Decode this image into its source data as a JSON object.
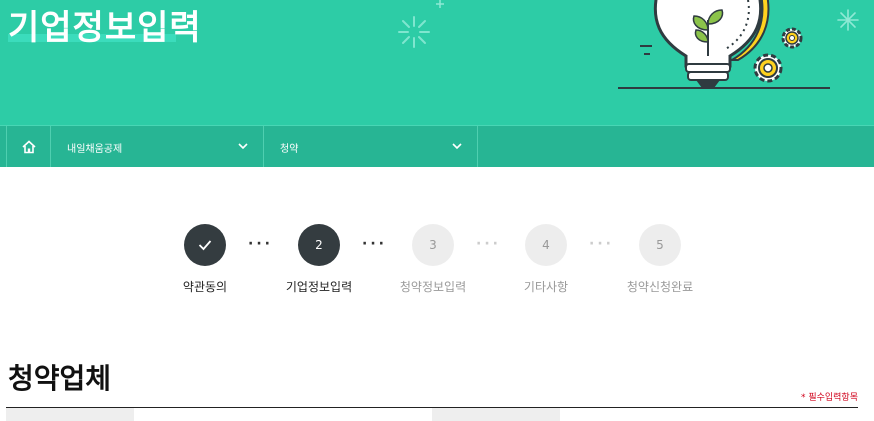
{
  "banner": {
    "title": "기업정보입력"
  },
  "nav": {
    "home_icon": "home-icon",
    "dropdowns": [
      {
        "label": "내일채움공제",
        "icon": "chevron-down-icon"
      },
      {
        "label": "청약",
        "icon": "chevron-down-icon"
      }
    ]
  },
  "steps": [
    {
      "number": "",
      "label": "약관동의",
      "state": "done",
      "icon": "check-icon"
    },
    {
      "number": "2",
      "label": "기업정보입력",
      "state": "active"
    },
    {
      "number": "3",
      "label": "청약정보입력",
      "state": "pending"
    },
    {
      "number": "4",
      "label": "기타사항",
      "state": "pending"
    },
    {
      "number": "5",
      "label": "청약신청완료",
      "state": "pending"
    }
  ],
  "step_separator": "···",
  "section": {
    "title": "청약업체",
    "required_note": "* 필수입력항목"
  },
  "colors": {
    "banner": "#2dcca6",
    "navbar": "#27b594",
    "step_active": "#343c40",
    "step_pending": "#ededed",
    "required": "#d0021b"
  }
}
